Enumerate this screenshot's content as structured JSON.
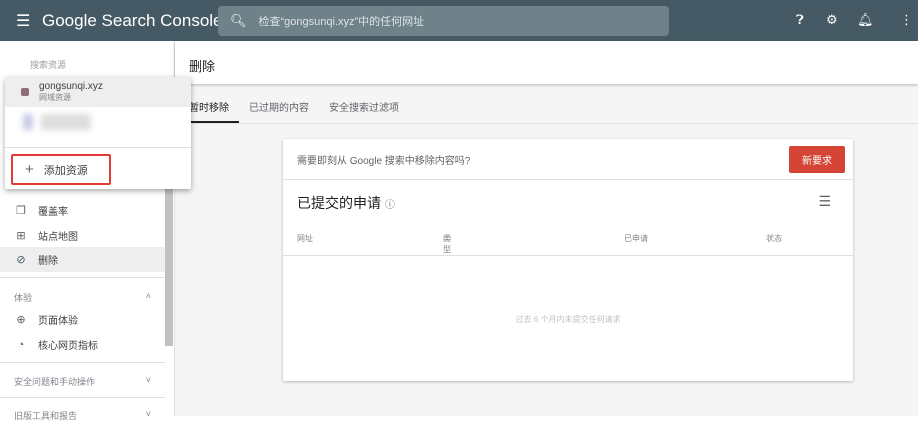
{
  "header": {
    "app_title": "Google Search Console",
    "search_placeholder": "检查“gongsunqi.xyz”中的任何网址"
  },
  "sidebar": {
    "section_label": "搜索资源",
    "items": [
      {
        "label": "覆盖率"
      },
      {
        "label": "站点地图"
      },
      {
        "label": "删除"
      }
    ],
    "experience": {
      "label": "体验",
      "items": [
        {
          "label": "页面体验"
        },
        {
          "label": "核心网页指标"
        }
      ]
    },
    "security_label": "安全问题和手动操作",
    "legacy_label": "旧版工具和报告"
  },
  "property_menu": {
    "current": {
      "name": "gongsunqi.xyz",
      "type": "网域资源"
    },
    "add_label": "添加资源"
  },
  "main": {
    "title": "删除",
    "tabs": [
      {
        "label": "暂时移除"
      },
      {
        "label": "已过期的内容"
      },
      {
        "label": "安全搜索过滤项"
      }
    ],
    "card": {
      "prompt": "需要即刻从 Google 搜索中移除内容吗?",
      "new_request": "新要求",
      "section_title": "已提交的申请",
      "columns": [
        "网址",
        "类型",
        "已申请",
        "状态"
      ],
      "empty": "过去 6 个月内未提交任何请求"
    }
  }
}
